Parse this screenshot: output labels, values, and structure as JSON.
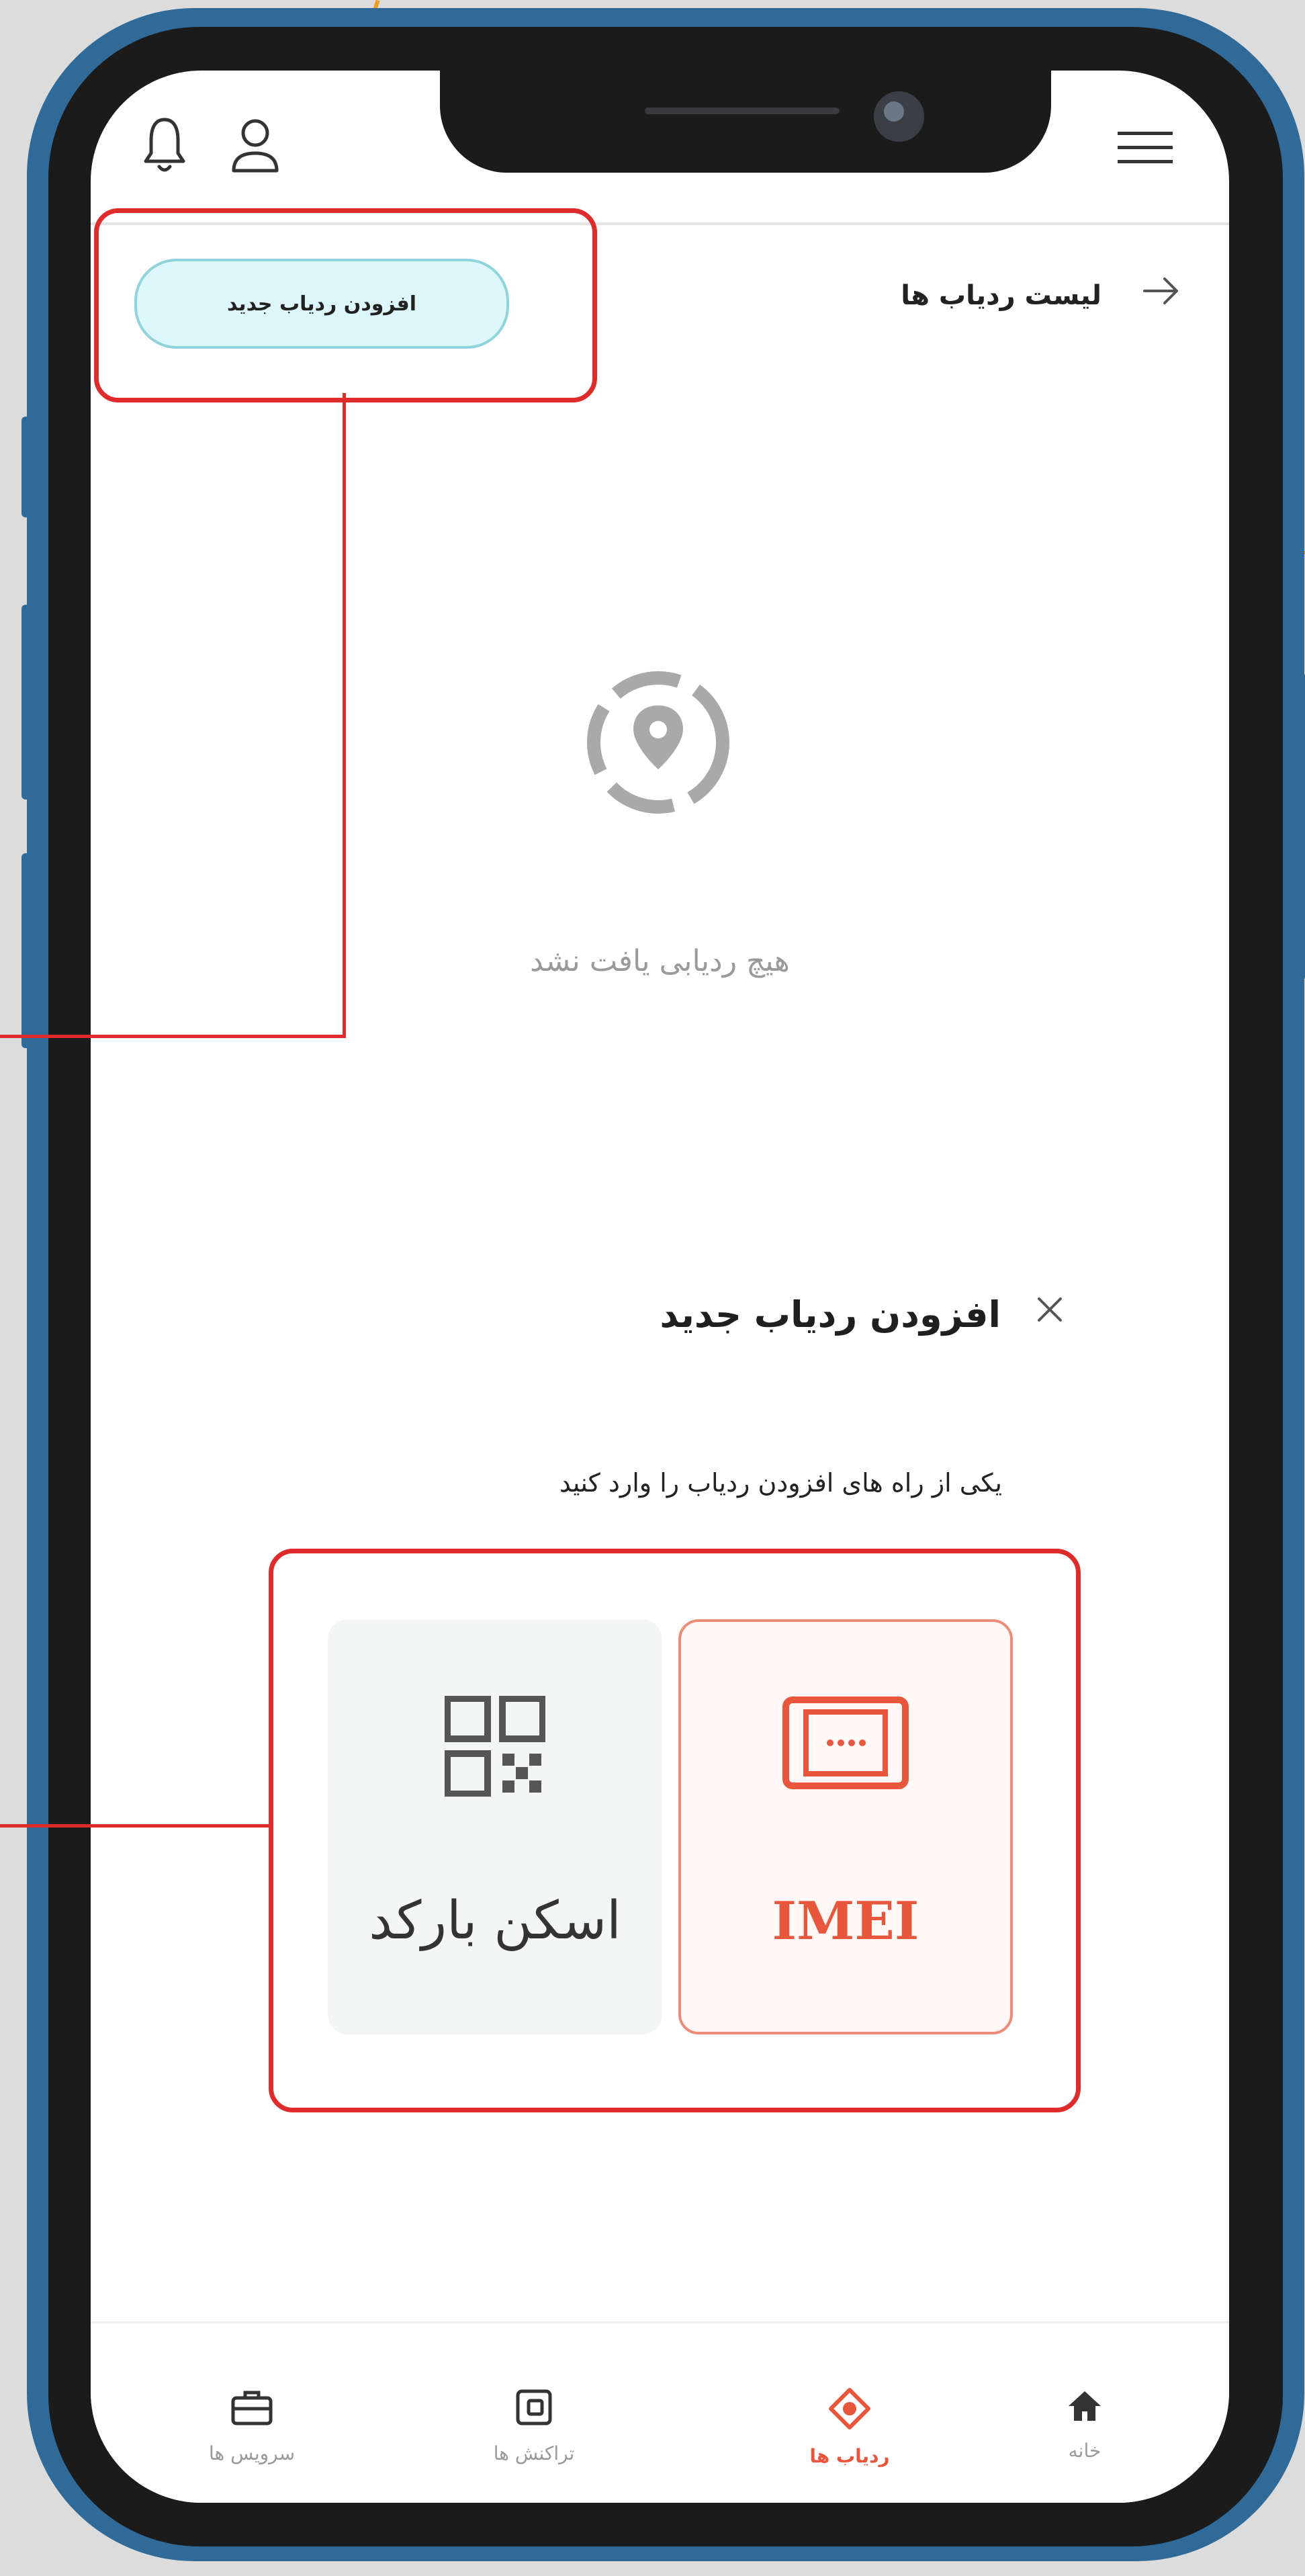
{
  "header": {
    "menu_icon": "hamburger-menu-icon",
    "bell_icon": "bell-icon",
    "profile_icon": "user-icon"
  },
  "subheader": {
    "title": "لیست ردیاب ها",
    "add_button_label": "افزودن ردیاب جدید"
  },
  "empty_state": {
    "icon": "location-target-icon",
    "text": "هیچ ردیابی یافت نشد"
  },
  "sheet": {
    "title": "افزودن ردیاب جدید",
    "description": "یکی از راه های افزودن ردیاب را وارد کنید",
    "options": [
      {
        "label": "IMEI",
        "icon": "device-imei-icon",
        "selected": true
      },
      {
        "label": "اسکن بارکد",
        "icon": "qr-code-icon",
        "selected": false
      }
    ]
  },
  "bottom_nav": [
    {
      "label": "خانه",
      "icon": "home-icon",
      "active": false
    },
    {
      "label": "ردیاب ها",
      "icon": "tracker-icon",
      "active": true
    },
    {
      "label": "تراکنش ها",
      "icon": "wallet-icon",
      "active": false
    },
    {
      "label": "سرویس ها",
      "icon": "briefcase-icon",
      "active": false
    }
  ],
  "colors": {
    "accent": "#e8573c",
    "add_button_bg": "#def7fa",
    "callout": "#e02b2b",
    "phone_frame": "#2f6a98"
  }
}
